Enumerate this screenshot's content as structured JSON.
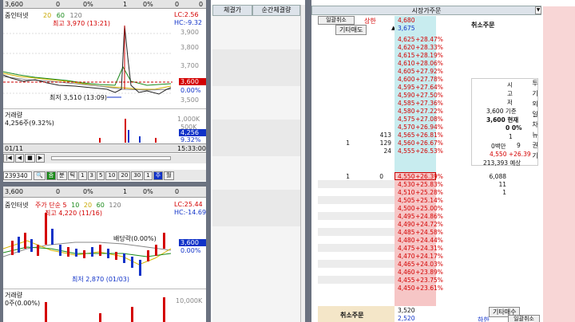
{
  "top_chart": {
    "header": {
      "price": "3,600",
      "change": "0",
      "pct": "0%",
      "vol": "1",
      "vol_pct": "0%",
      "x": "0",
      "y": "0"
    },
    "legend": "줌인터넷",
    "legend_nums": [
      "20",
      "60",
      "120"
    ],
    "lc": "LC:2.56",
    "hc": "HC:-9.32",
    "high_label": "최고 3,970 (13:21)",
    "low_label": "최저 3,510 (13:09)",
    "y_ticks": [
      "3,900",
      "3,800",
      "3,700",
      "3,600",
      "3,500"
    ],
    "price_tag": "3,600",
    "price_pct": "0.00%",
    "volume_title": "거래량",
    "volume_value": "4,256주(9.32%)",
    "vol_ticks": [
      "1,000K",
      "500K"
    ],
    "vol_tag": "4,256",
    "vol_pct_tag": "9.32%",
    "time_left": "01/11",
    "time_right": "15:33:00",
    "code": "239340",
    "toolbar_labels": [
      "줌",
      "분",
      "틱",
      "1",
      "3",
      "5",
      "10",
      "20",
      "30",
      "1",
      "주",
      "월"
    ]
  },
  "bottom_chart": {
    "header": {
      "price": "3,600",
      "change": "0",
      "pct": "0%",
      "vol": "1",
      "vol_pct": "0%",
      "x": "0"
    },
    "legend": "줌인터넷",
    "legend2": "주가 단순 5",
    "legend_nums": [
      "10",
      "20",
      "60",
      "120"
    ],
    "lc": "LC:25.44",
    "hc": "HC:-14.69",
    "high_label": "최고 4,220 (11/16)",
    "low_label": "최저 2,870 (01/03)",
    "event_label": "배당락(0.00%)",
    "price_tag": "3,600",
    "price_pct": "0.00%",
    "volume_title": "거래량",
    "volume_value": "0주(0.00%)",
    "vol_ticks": [
      "10,000K"
    ]
  },
  "exec": {
    "col1": "체결가",
    "col2": "순간체결량"
  },
  "orderbook": {
    "title": "시장가주문",
    "btn_cancel_all": "일괄취소",
    "upper_limit": "상한",
    "other_sell": "기타매도",
    "cancel_order": "취소주문",
    "upper_price": "4,680",
    "upper_price2": "3,675",
    "asks": [
      [
        "",
        "",
        "",
        "4,625",
        "+28.47%"
      ],
      [
        "",
        "",
        "",
        "4,620",
        "+28.33%"
      ],
      [
        "",
        "",
        "",
        "4,615",
        "+28.19%"
      ],
      [
        "",
        "",
        "",
        "4,610",
        "+28.06%"
      ],
      [
        "",
        "",
        "",
        "4,605",
        "+27.92%"
      ],
      [
        "",
        "",
        "",
        "4,600",
        "+27.78%"
      ],
      [
        "",
        "",
        "",
        "4,595",
        "+27.64%"
      ],
      [
        "",
        "",
        "",
        "4,590",
        "+27.50%"
      ],
      [
        "",
        "",
        "",
        "4,585",
        "+27.36%"
      ],
      [
        "",
        "",
        "",
        "4,580",
        "+27.22%"
      ],
      [
        "",
        "",
        "",
        "4,575",
        "+27.08%"
      ],
      [
        "",
        "",
        "",
        "4,570",
        "+26.94%"
      ],
      [
        "",
        "413",
        "",
        "4,565",
        "+26.81%"
      ],
      [
        "1",
        "129",
        "",
        "4,560",
        "+26.67%"
      ],
      [
        "",
        "24",
        "",
        "4,555",
        "+26.53%"
      ]
    ],
    "bids": [
      [
        "1",
        "0",
        "4,550",
        "+26.39%",
        "6,088"
      ],
      [
        "",
        "",
        "4,530",
        "+25.83%",
        "11"
      ],
      [
        "",
        "",
        "4,510",
        "+25.28%",
        "1"
      ],
      [
        "",
        "",
        "4,505",
        "+25.14%",
        ""
      ],
      [
        "",
        "",
        "4,500",
        "+25.00%",
        ""
      ],
      [
        "",
        "",
        "4,495",
        "+24.86%",
        ""
      ],
      [
        "",
        "",
        "4,490",
        "+24.72%",
        ""
      ],
      [
        "",
        "",
        "4,485",
        "+24.58%",
        ""
      ],
      [
        "",
        "",
        "4,480",
        "+24.44%",
        ""
      ],
      [
        "",
        "",
        "4,475",
        "+24.31%",
        ""
      ],
      [
        "",
        "",
        "4,470",
        "+24.17%",
        ""
      ],
      [
        "",
        "",
        "4,465",
        "+24.03%",
        ""
      ],
      [
        "",
        "",
        "4,460",
        "+23.89%",
        ""
      ],
      [
        "",
        "",
        "4,455",
        "+23.75%",
        ""
      ],
      [
        "",
        "",
        "4,450",
        "+23.61%",
        ""
      ]
    ],
    "info": {
      "l1": "시",
      "l2": "고",
      "l3": "저",
      "base": "3,600 기준",
      "cur": "3,600 현재",
      "zero1": "0 0%",
      "one": "1",
      "vol": "0백만",
      "nine": "9",
      "pred": "4,550 +26.39",
      "pred_vol": "213,393 예상"
    },
    "side_chars": [
      "투",
      "기",
      "외",
      "일",
      "차",
      "뉴",
      "권",
      "기"
    ],
    "bottom": {
      "cancel": "취소주문",
      "other_buy": "기타매수",
      "v1": "3,520",
      "v2": "2,520",
      "lower": "하한",
      "cancel_all": "일괄취소"
    }
  }
}
